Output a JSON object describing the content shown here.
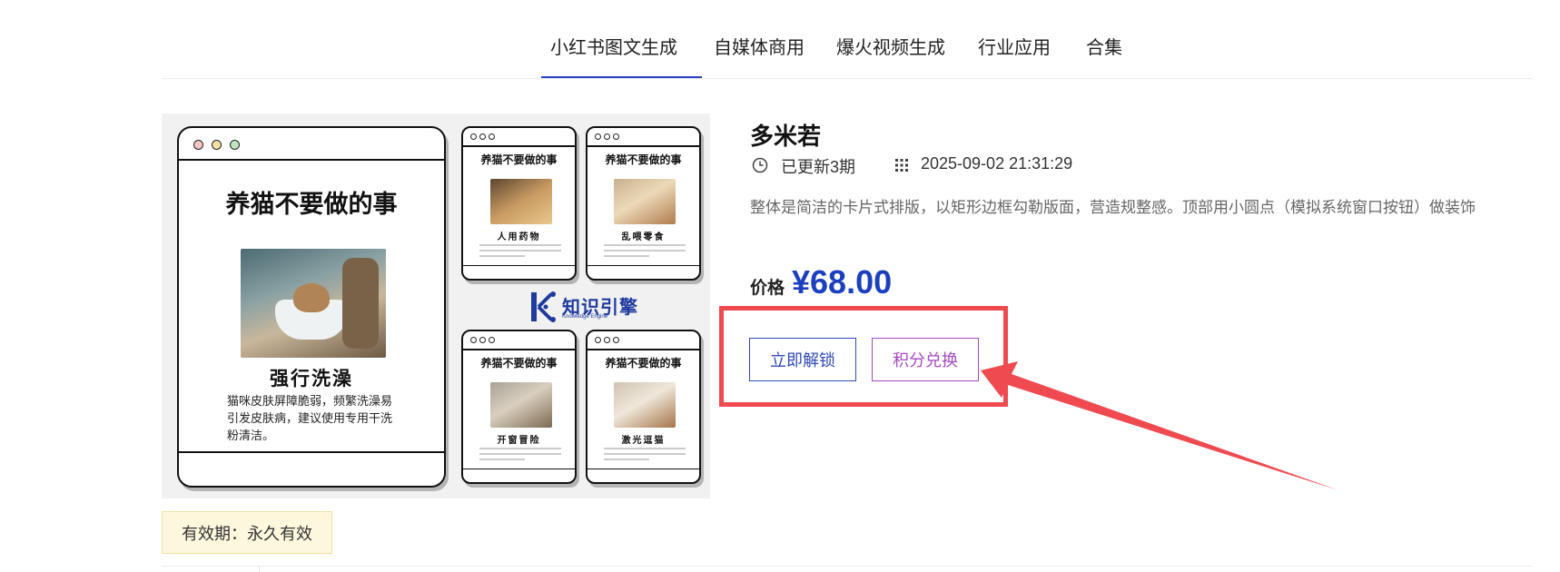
{
  "tabs": [
    {
      "label": "小红书图文生成",
      "active": true
    },
    {
      "label": "自媒体商用",
      "active": false
    },
    {
      "label": "爆火视频生成",
      "active": false
    },
    {
      "label": "行业应用",
      "active": false
    },
    {
      "label": "合集",
      "active": false
    }
  ],
  "preview": {
    "main_card": {
      "title": "养猫不要做的事",
      "caption": "强行洗澡",
      "desc_line1": "猫咪皮肤屏障脆弱，频繁洗澡易",
      "desc_line2": "引发皮肤病，建议使用专用干洗",
      "desc_line3": "粉清洁。"
    },
    "small_cards": [
      {
        "title": "养猫不要做的事",
        "caption": "人用药物"
      },
      {
        "title": "养猫不要做的事",
        "caption": "乱喂零食"
      },
      {
        "title": "养猫不要做的事",
        "caption": "开窗冒险"
      },
      {
        "title": "养猫不要做的事",
        "caption": "激光逗猫"
      }
    ],
    "logo": {
      "name": "知识引擎",
      "sub": "Knowledge Engine"
    }
  },
  "product": {
    "title": "多米若",
    "updates": "已更新3期",
    "updated_at": "2025-09-02 21:31:29",
    "summary": "整体是简洁的卡片式排版，以矩形边框勾勒版面，营造规整感。顶部用小圆点（模拟系统窗口按钮）做装饰",
    "price_label": "价格",
    "price": "¥68.00",
    "unlock_label": "立即解锁",
    "points_label": "积分兑换",
    "validity": "有效期：永久有效"
  },
  "icons": {
    "updates": "clock-icon",
    "date": "calendar-icon"
  },
  "colors": {
    "accent": "#2b3fc7",
    "price": "#1c3fbf",
    "points": "#a64ac2",
    "annotation": "#ef4a4f",
    "validity_bg": "#fdf8dd"
  }
}
